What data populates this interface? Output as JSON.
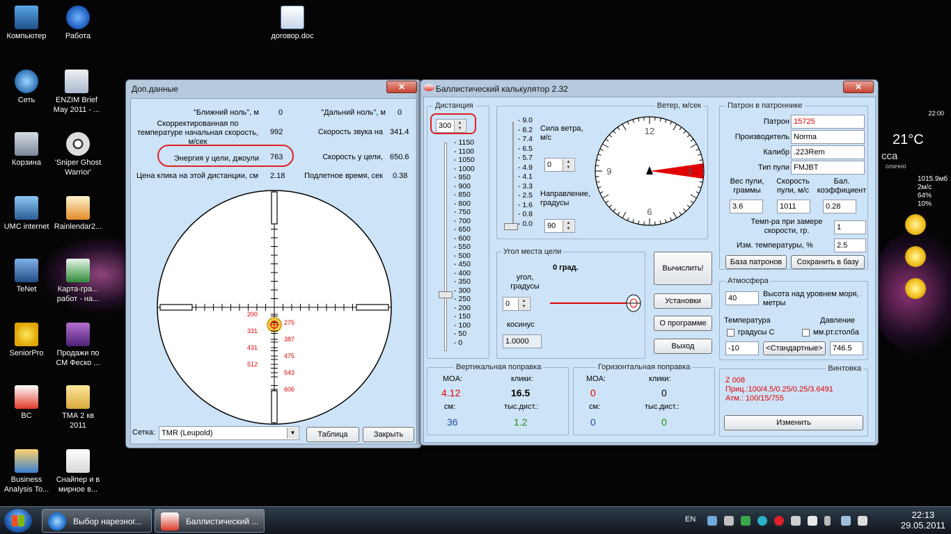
{
  "desktop": {
    "icons": [
      {
        "name": "icon-computer",
        "label": "Компьютер",
        "glyph": "computer-icon"
      },
      {
        "name": "icon-work",
        "label": "Работа",
        "glyph": "info-icon"
      },
      {
        "name": "icon-doc",
        "label": "договор.doc",
        "glyph": "word-document-icon"
      },
      {
        "name": "icon-network",
        "label": "Сеть",
        "glyph": "network-icon"
      },
      {
        "name": "icon-enzim",
        "label": "ENZIM Brief\nMay 2011 - ...",
        "glyph": "document-icon"
      },
      {
        "name": "icon-recycle",
        "label": "Корзина",
        "glyph": "recycle-bin-icon"
      },
      {
        "name": "icon-sniper",
        "label": "'Sniper Ghost\nWarrior'",
        "glyph": "crosshair-icon"
      },
      {
        "name": "icon-umc",
        "label": "UMC internet",
        "glyph": "network-icon"
      },
      {
        "name": "icon-rainlendar",
        "label": "Rainlendar2...",
        "glyph": "calendar-icon"
      },
      {
        "name": "icon-tenet",
        "label": "TeNet",
        "glyph": "network-icon"
      },
      {
        "name": "icon-karta",
        "label": "Карта-гра...\nработ -  на...",
        "glyph": "excel-icon"
      },
      {
        "name": "icon-seniorpro",
        "label": "SeniorPro",
        "glyph": "star-icon"
      },
      {
        "name": "icon-prodazhi",
        "label": "Продажи по\nСМ Феско ...",
        "glyph": "archive-icon"
      },
      {
        "name": "icon-bc",
        "label": "BC",
        "glyph": "bullet-icon"
      },
      {
        "name": "icon-tma",
        "label": "ТМА 2 кв\n2011",
        "glyph": "folder-icon"
      },
      {
        "name": "icon-business",
        "label": "Business\nAnalysis To...",
        "glyph": "cube-icon"
      },
      {
        "name": "icon-snaiper",
        "label": "Снайпер и в\nмирное в...",
        "glyph": "document-icon"
      }
    ],
    "weather": {
      "time": "22:00",
      "temp": "21°C",
      "city": "сса",
      "city_sub": "олачно",
      "pressure": "1015.9мб",
      "wind": "2м/с",
      "humidity": "64%",
      "clouds": "10%"
    }
  },
  "dop": {
    "title": "Доп.данные",
    "close": "✕",
    "near_zero_label": "\"Ближний ноль\", м",
    "near_zero_value": "0",
    "far_zero_label": "\"Дальний ноль\", м",
    "far_zero_value": "0",
    "corr_speed_label": "Скорректированная по\nтемпературе начальная скорость,\nм/сек",
    "corr_speed_value": "992",
    "sound_label": "Скорость звука на",
    "sound_value": "341.4",
    "energy_label": "Энергия у цели, джоули",
    "energy_value": "763",
    "target_speed_label": "Скорость у цели,",
    "target_speed_value": "650.6",
    "click_label": "Цена клика на этой дистанции, см",
    "click_value": "2.18",
    "flight_label": "Подлетное время, сек",
    "flight_value": "0.38",
    "reticle_marks": [
      "200",
      "275",
      "331",
      "387",
      "431",
      "475",
      "512",
      "543",
      "606"
    ],
    "grid_label": "Сетка:",
    "grid_value": "TMR (Leupold)",
    "table_btn": "Таблица",
    "close_btn": "Закрыть"
  },
  "calc": {
    "title": "Баллистический калькулятор 2.32",
    "close": "✕",
    "distance_group": "Дистанция",
    "distance_value": "300",
    "distance_scale": [
      "1150",
      "1100",
      "1050",
      "1000",
      "950",
      "900",
      "850",
      "800",
      "750",
      "700",
      "650",
      "600",
      "550",
      "500",
      "450",
      "400",
      "350",
      "300",
      "250",
      "200",
      "150",
      "100",
      "50",
      "0"
    ],
    "wind_group": "Ветер, м/сек",
    "wind_scale": [
      "9.0",
      "8.2",
      "7.4",
      "6.5",
      "5.7",
      "4.9",
      "4.1",
      "3.3",
      "2.5",
      "1.6",
      "0.8",
      "0.0"
    ],
    "wind_force_label": "Сила ветра,\nм/с",
    "wind_force_value": "0",
    "wind_dir_label": "Направление,\nградусы",
    "wind_dir_value": "90",
    "clock_12": "12",
    "clock_3": "3",
    "clock_6": "6",
    "clock_9": "9",
    "angle_group": "Угол места цели",
    "angle_deg": "0 град.",
    "angle_label": "угол,\nградусы",
    "angle_value": "0",
    "cos_label": "косинус",
    "cos_value": "1.0000",
    "btn_calc": "Вычислить!",
    "btn_settings": "Установки",
    "btn_about": "О программе",
    "btn_exit": "Выход",
    "vert_group": "Вертикальная поправка",
    "vert_moa_label": "MOA:",
    "vert_moa": "4.12",
    "vert_clicks_label": "клики:",
    "vert_clicks": "16.5",
    "vert_cm_label": "см:",
    "vert_cm": "36",
    "vert_k_label": "тыс.дист.:",
    "vert_k": "1.2",
    "hor_group": "Горизонтальная поправка",
    "hor_moa_label": "MOA:",
    "hor_moa": "0",
    "hor_clicks_label": "клики:",
    "hor_clicks": "0",
    "hor_cm_label": "см:",
    "hor_cm": "0",
    "hor_k_label": "тыс.дист.:",
    "hor_k": "0",
    "cart_group": "Патрон в патроннике",
    "cart_label": "Патрон",
    "cart_value": "15725",
    "maker_label": "Производитель",
    "maker_value": "Norma",
    "caliber_label": "Калибр",
    "caliber_value": ".223Rem",
    "bullet_label": "Тип пули",
    "bullet_value": "FMJBT",
    "weight_label": "Вес пули,\nграммы",
    "weight_value": "3.6",
    "speed_label": "Скорость\nпули, м/с",
    "speed_value": "1011",
    "bc_label": "Бал.\nкоэффициент",
    "bc_value": "0.28",
    "temp_meas_label": "Темп-ра при замере\nскорости, гр.",
    "temp_meas_value": "1",
    "temp_change_label": "Изм. температуры, %",
    "temp_change_value": "2.5",
    "btn_base": "База патронов",
    "btn_save": "Сохранить в базу",
    "atm_group": "Атмосфера",
    "alt_value": "40",
    "alt_label": "Высота над уровнем моря,\nметры",
    "temp_label": "Температура",
    "temp_unit": "градусы С",
    "press_label": "Давление",
    "press_unit": "мм.рт.столба",
    "temp_value": "-10",
    "btn_std": "<Стандартные>",
    "press_value": "746.5",
    "rifle_group": "Винтовка",
    "rifle_line1": "Z 008",
    "rifle_line2": "Приц.:100/4.5/0.25/0.25/3.6491",
    "rifle_line3": "Атм.:  100/15/755",
    "btn_change": "Изменить"
  },
  "taskbar": {
    "task1": "Выбор нарезног...",
    "task2": "Баллистический ...",
    "lang": "EN",
    "time": "22:13",
    "date": "29.05.2011"
  },
  "colors": {
    "highlight": "#e00000",
    "window_bg": "#cde3f7",
    "frame": "#b6c9dd"
  }
}
